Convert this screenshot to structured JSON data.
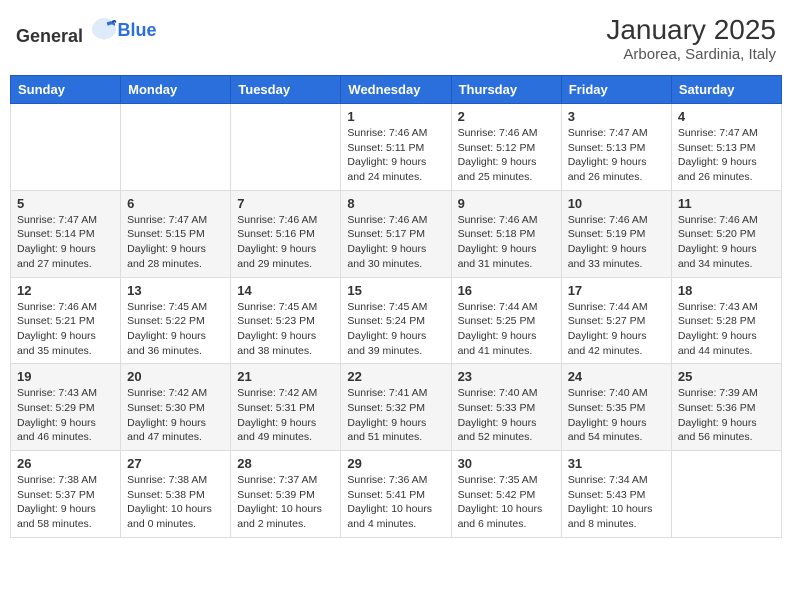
{
  "logo": {
    "text_general": "General",
    "text_blue": "Blue"
  },
  "header": {
    "month": "January 2025",
    "location": "Arborea, Sardinia, Italy"
  },
  "weekdays": [
    "Sunday",
    "Monday",
    "Tuesday",
    "Wednesday",
    "Thursday",
    "Friday",
    "Saturday"
  ],
  "weeks": [
    [
      {
        "day": "",
        "info": ""
      },
      {
        "day": "",
        "info": ""
      },
      {
        "day": "",
        "info": ""
      },
      {
        "day": "1",
        "info": "Sunrise: 7:46 AM\nSunset: 5:11 PM\nDaylight: 9 hours and 24 minutes."
      },
      {
        "day": "2",
        "info": "Sunrise: 7:46 AM\nSunset: 5:12 PM\nDaylight: 9 hours and 25 minutes."
      },
      {
        "day": "3",
        "info": "Sunrise: 7:47 AM\nSunset: 5:13 PM\nDaylight: 9 hours and 26 minutes."
      },
      {
        "day": "4",
        "info": "Sunrise: 7:47 AM\nSunset: 5:13 PM\nDaylight: 9 hours and 26 minutes."
      }
    ],
    [
      {
        "day": "5",
        "info": "Sunrise: 7:47 AM\nSunset: 5:14 PM\nDaylight: 9 hours and 27 minutes."
      },
      {
        "day": "6",
        "info": "Sunrise: 7:47 AM\nSunset: 5:15 PM\nDaylight: 9 hours and 28 minutes."
      },
      {
        "day": "7",
        "info": "Sunrise: 7:46 AM\nSunset: 5:16 PM\nDaylight: 9 hours and 29 minutes."
      },
      {
        "day": "8",
        "info": "Sunrise: 7:46 AM\nSunset: 5:17 PM\nDaylight: 9 hours and 30 minutes."
      },
      {
        "day": "9",
        "info": "Sunrise: 7:46 AM\nSunset: 5:18 PM\nDaylight: 9 hours and 31 minutes."
      },
      {
        "day": "10",
        "info": "Sunrise: 7:46 AM\nSunset: 5:19 PM\nDaylight: 9 hours and 33 minutes."
      },
      {
        "day": "11",
        "info": "Sunrise: 7:46 AM\nSunset: 5:20 PM\nDaylight: 9 hours and 34 minutes."
      }
    ],
    [
      {
        "day": "12",
        "info": "Sunrise: 7:46 AM\nSunset: 5:21 PM\nDaylight: 9 hours and 35 minutes."
      },
      {
        "day": "13",
        "info": "Sunrise: 7:45 AM\nSunset: 5:22 PM\nDaylight: 9 hours and 36 minutes."
      },
      {
        "day": "14",
        "info": "Sunrise: 7:45 AM\nSunset: 5:23 PM\nDaylight: 9 hours and 38 minutes."
      },
      {
        "day": "15",
        "info": "Sunrise: 7:45 AM\nSunset: 5:24 PM\nDaylight: 9 hours and 39 minutes."
      },
      {
        "day": "16",
        "info": "Sunrise: 7:44 AM\nSunset: 5:25 PM\nDaylight: 9 hours and 41 minutes."
      },
      {
        "day": "17",
        "info": "Sunrise: 7:44 AM\nSunset: 5:27 PM\nDaylight: 9 hours and 42 minutes."
      },
      {
        "day": "18",
        "info": "Sunrise: 7:43 AM\nSunset: 5:28 PM\nDaylight: 9 hours and 44 minutes."
      }
    ],
    [
      {
        "day": "19",
        "info": "Sunrise: 7:43 AM\nSunset: 5:29 PM\nDaylight: 9 hours and 46 minutes."
      },
      {
        "day": "20",
        "info": "Sunrise: 7:42 AM\nSunset: 5:30 PM\nDaylight: 9 hours and 47 minutes."
      },
      {
        "day": "21",
        "info": "Sunrise: 7:42 AM\nSunset: 5:31 PM\nDaylight: 9 hours and 49 minutes."
      },
      {
        "day": "22",
        "info": "Sunrise: 7:41 AM\nSunset: 5:32 PM\nDaylight: 9 hours and 51 minutes."
      },
      {
        "day": "23",
        "info": "Sunrise: 7:40 AM\nSunset: 5:33 PM\nDaylight: 9 hours and 52 minutes."
      },
      {
        "day": "24",
        "info": "Sunrise: 7:40 AM\nSunset: 5:35 PM\nDaylight: 9 hours and 54 minutes."
      },
      {
        "day": "25",
        "info": "Sunrise: 7:39 AM\nSunset: 5:36 PM\nDaylight: 9 hours and 56 minutes."
      }
    ],
    [
      {
        "day": "26",
        "info": "Sunrise: 7:38 AM\nSunset: 5:37 PM\nDaylight: 9 hours and 58 minutes."
      },
      {
        "day": "27",
        "info": "Sunrise: 7:38 AM\nSunset: 5:38 PM\nDaylight: 10 hours and 0 minutes."
      },
      {
        "day": "28",
        "info": "Sunrise: 7:37 AM\nSunset: 5:39 PM\nDaylight: 10 hours and 2 minutes."
      },
      {
        "day": "29",
        "info": "Sunrise: 7:36 AM\nSunset: 5:41 PM\nDaylight: 10 hours and 4 minutes."
      },
      {
        "day": "30",
        "info": "Sunrise: 7:35 AM\nSunset: 5:42 PM\nDaylight: 10 hours and 6 minutes."
      },
      {
        "day": "31",
        "info": "Sunrise: 7:34 AM\nSunset: 5:43 PM\nDaylight: 10 hours and 8 minutes."
      },
      {
        "day": "",
        "info": ""
      }
    ]
  ]
}
